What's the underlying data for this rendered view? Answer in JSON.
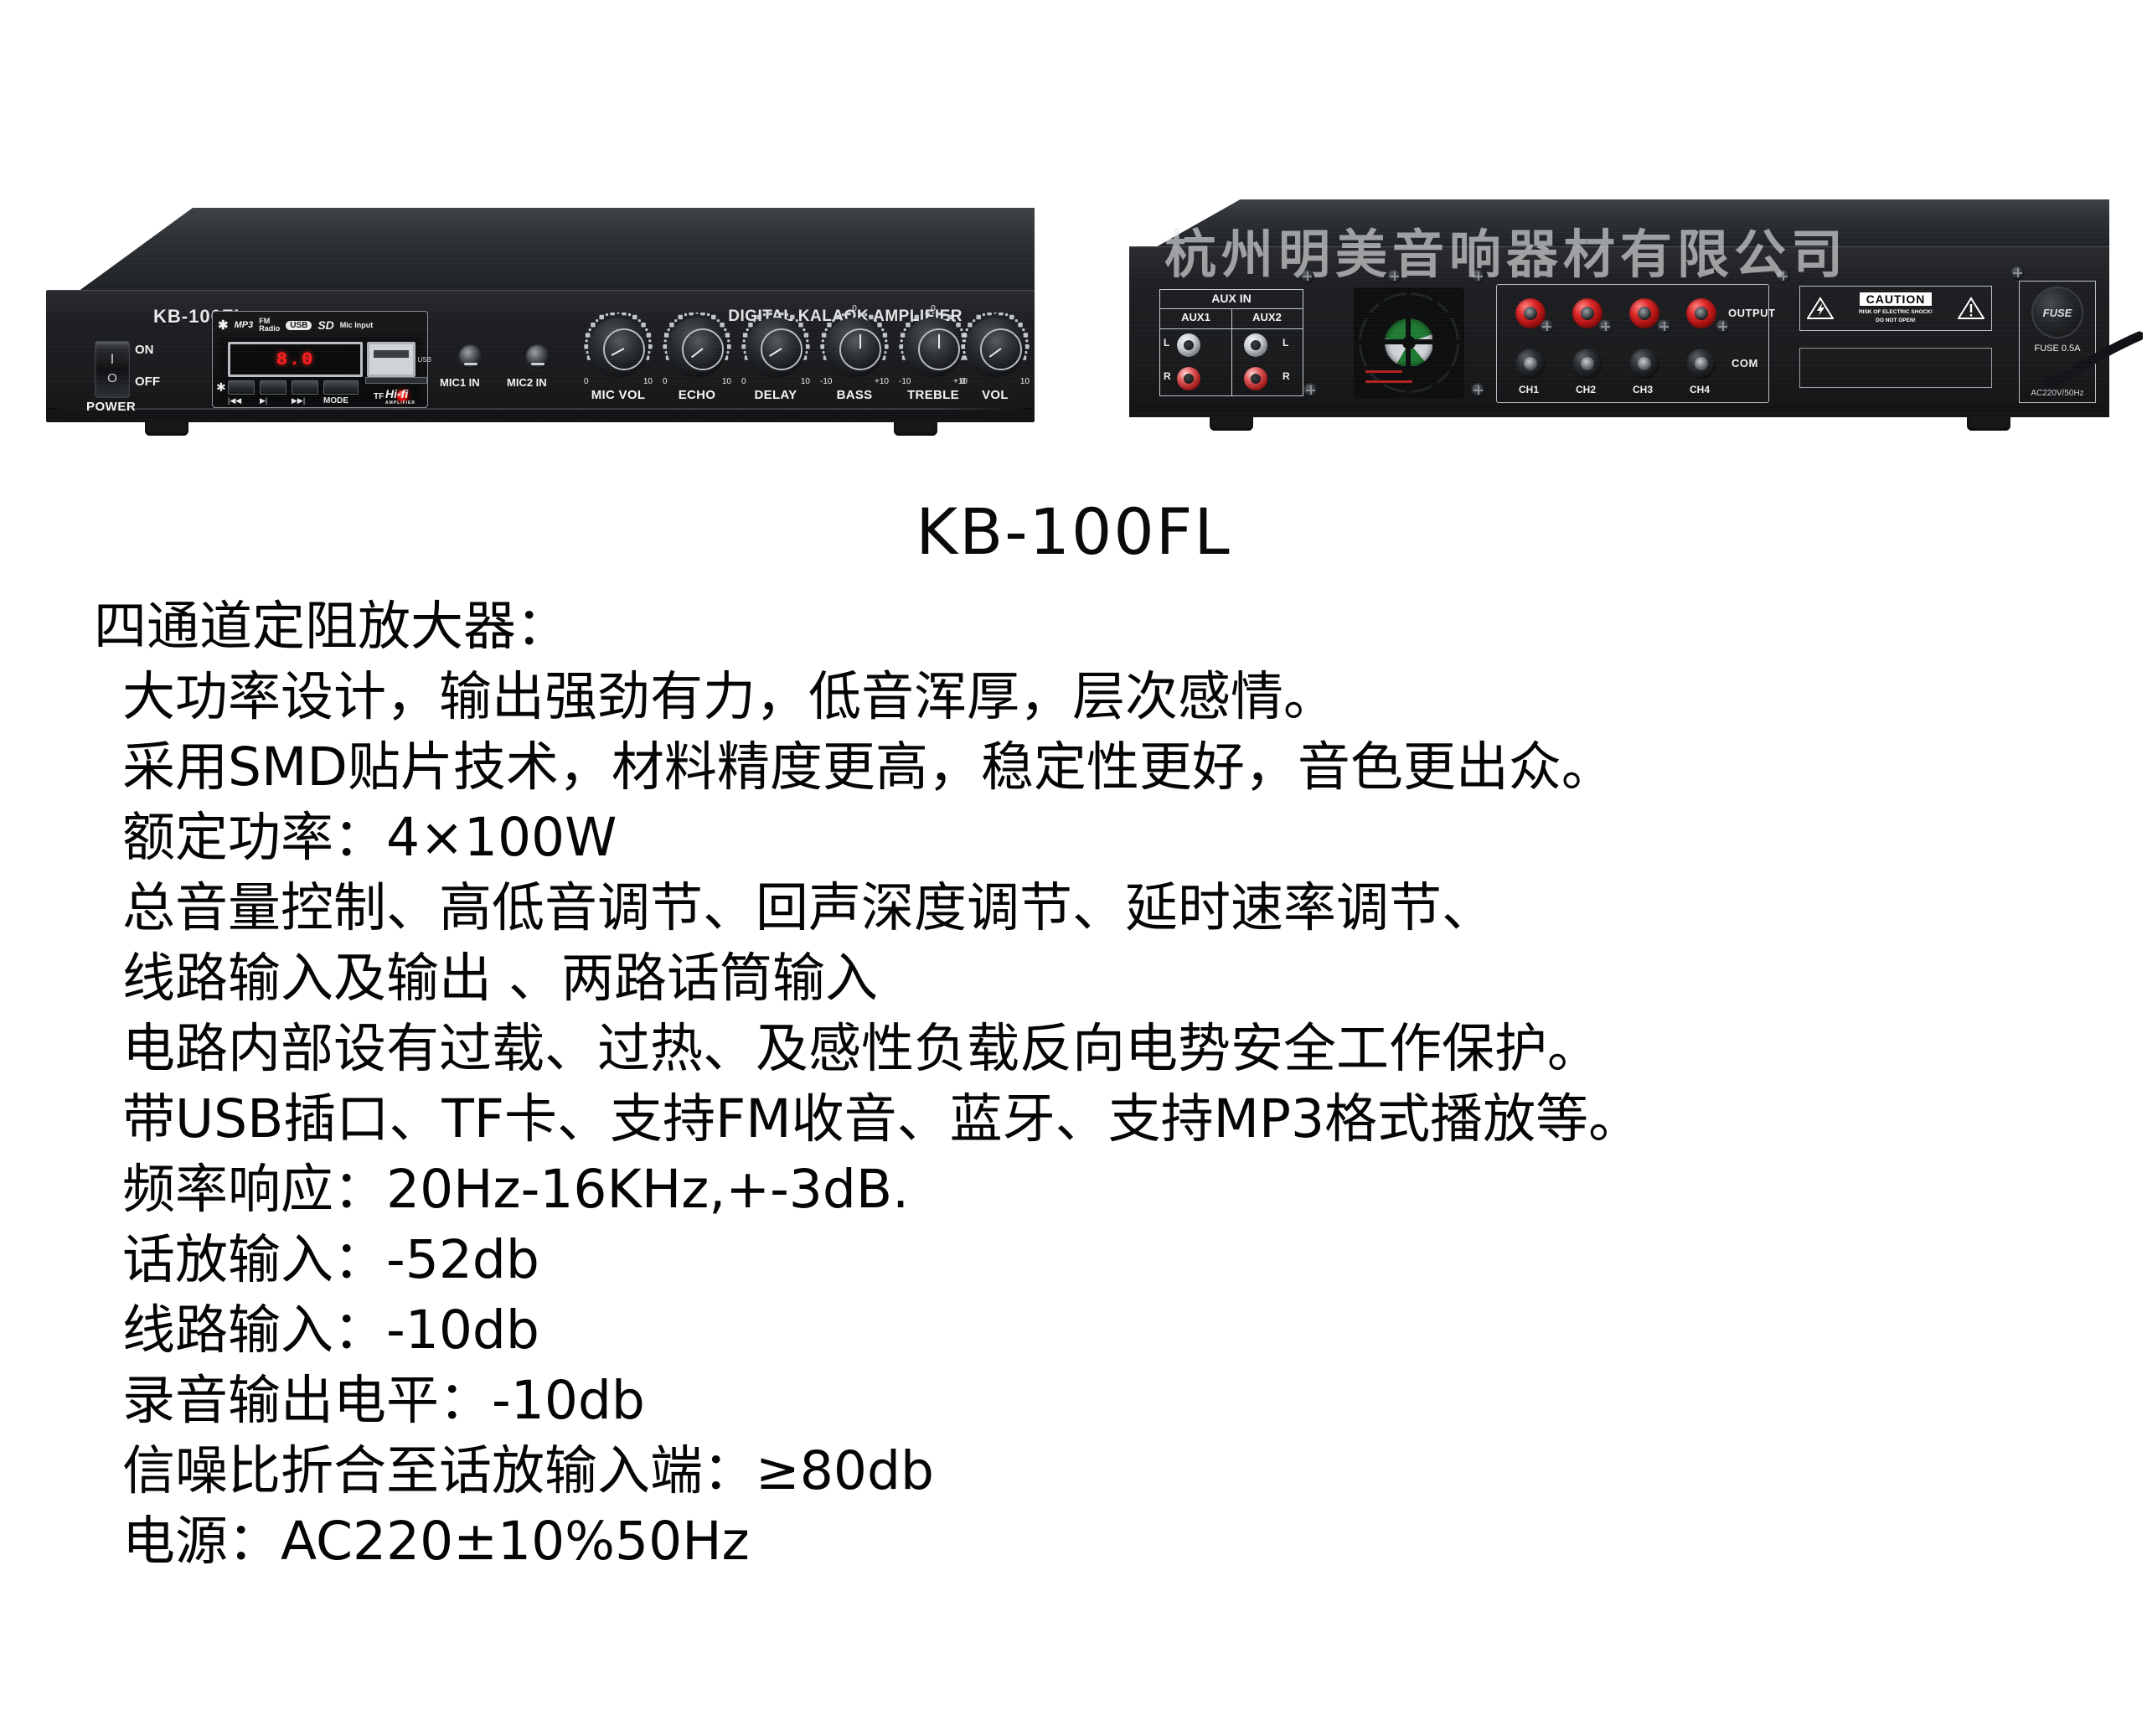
{
  "product": {
    "model": "KB-100FL",
    "front_model_label": "KB-100FL",
    "front_brand_right": "DIGITAL KALAOK AMPLIFIER",
    "watermark": "杭州明美音响器材有限公司"
  },
  "front_panel": {
    "power": {
      "on": "ON",
      "off": "OFF",
      "caption": "POWER",
      "symbol_on": "I",
      "symbol_off": "O"
    },
    "mp3_module": {
      "feature_icons": [
        {
          "name": "bluetooth-icon",
          "glyph": "✱"
        },
        {
          "name": "mp3-audio-icon",
          "label": "MP3"
        },
        {
          "name": "fm-radio-icon",
          "label": "FM\nRadio"
        },
        {
          "name": "usb-icon",
          "label": "USB"
        },
        {
          "name": "sd-card-icon",
          "label": "SD"
        },
        {
          "name": "mic-input-icon",
          "label": "Mic Input"
        }
      ],
      "display_value": "8.0",
      "usb_port_label": "USB",
      "buttons": [
        {
          "name": "previous-track-button",
          "label": "|◀◀"
        },
        {
          "name": "play-pause-button",
          "label": "▶|"
        },
        {
          "name": "next-track-button",
          "label": "▶▶|"
        },
        {
          "name": "mode-button",
          "label": "MODE"
        }
      ],
      "tf_label": "TF",
      "hifi_label": "Hi-fi",
      "hifi_sub": "AMPLIFIER"
    },
    "jacks": [
      {
        "name": "mic1-input-jack",
        "label": "MIC1 IN"
      },
      {
        "name": "mic2-input-jack",
        "label": "MIC2 IN"
      }
    ],
    "knobs": [
      {
        "name": "mic-vol-knob",
        "label": "MIC  VOL",
        "min": "0",
        "max": "10",
        "mid": "",
        "angle": -118
      },
      {
        "name": "echo-knob",
        "label": "ECHO",
        "min": "0",
        "max": "10",
        "mid": "",
        "angle": -128
      },
      {
        "name": "delay-knob",
        "label": "DELAY",
        "min": "0",
        "max": "10",
        "mid": "",
        "angle": -122
      },
      {
        "name": "bass-knob",
        "label": "BASS",
        "min": "-10",
        "max": "+10",
        "mid": "0",
        "angle": 0
      },
      {
        "name": "treble-knob",
        "label": "TREBLE",
        "min": "-10",
        "max": "+10",
        "mid": "0",
        "angle": 0
      },
      {
        "name": "volume-knob",
        "label": "VOL",
        "min": "0",
        "max": "10",
        "mid": "",
        "angle": -126
      }
    ]
  },
  "rear_panel": {
    "aux": {
      "title": "AUX IN",
      "ch1": "AUX1",
      "ch2": "AUX2",
      "left_label": "L",
      "right_label": "R"
    },
    "output": {
      "output_label": "OUTPUT",
      "com_label": "COM",
      "channels": [
        "CH1",
        "CH2",
        "CH3",
        "CH4"
      ]
    },
    "caution": {
      "title": "CAUTION",
      "line1": "RISK OF ELECTRIC SHOCK!",
      "line2": "DO NOT OPEN!"
    },
    "fuse": {
      "cap_label": "FUSE",
      "rating": "FUSE 0.5A",
      "mains": "AC220V/50Hz"
    }
  },
  "specs": {
    "title": "KB-100FL",
    "lines": [
      {
        "text": "四通道定阻放大器：",
        "indent": false
      },
      {
        "text": "大功率设计，输出强劲有力，低音浑厚，层次感情。",
        "indent": true
      },
      {
        "text": "采用SMD贴片技术，材料精度更高，稳定性更好，音色更出众。",
        "indent": true
      },
      {
        "text": "额定功率：4×100W",
        "indent": true
      },
      {
        "text": "总音量控制、高低音调节、回声深度调节、延时速率调节、",
        "indent": true
      },
      {
        "text": "线路输入及输出 、两路话筒输入",
        "indent": true
      },
      {
        "text": "电路内部设有过载、过热、及感性负载反向电势安全工作保护。",
        "indent": true
      },
      {
        "text": "带USB插口、TF卡、支持FM收音、蓝牙、支持MP3格式播放等。",
        "indent": true
      },
      {
        "text": "频率响应：20Hz-16KHz,+-3dB.",
        "indent": true
      },
      {
        "text": "话放输入：-52db",
        "indent": true
      },
      {
        "text": "线路输入：-10db",
        "indent": true
      },
      {
        "text": "录音输出电平：-10db",
        "indent": true
      },
      {
        "text": "信噪比折合至话放输入端：≥80db",
        "indent": true
      },
      {
        "text": "电源：AC220±10%50Hz",
        "indent": true
      }
    ]
  }
}
